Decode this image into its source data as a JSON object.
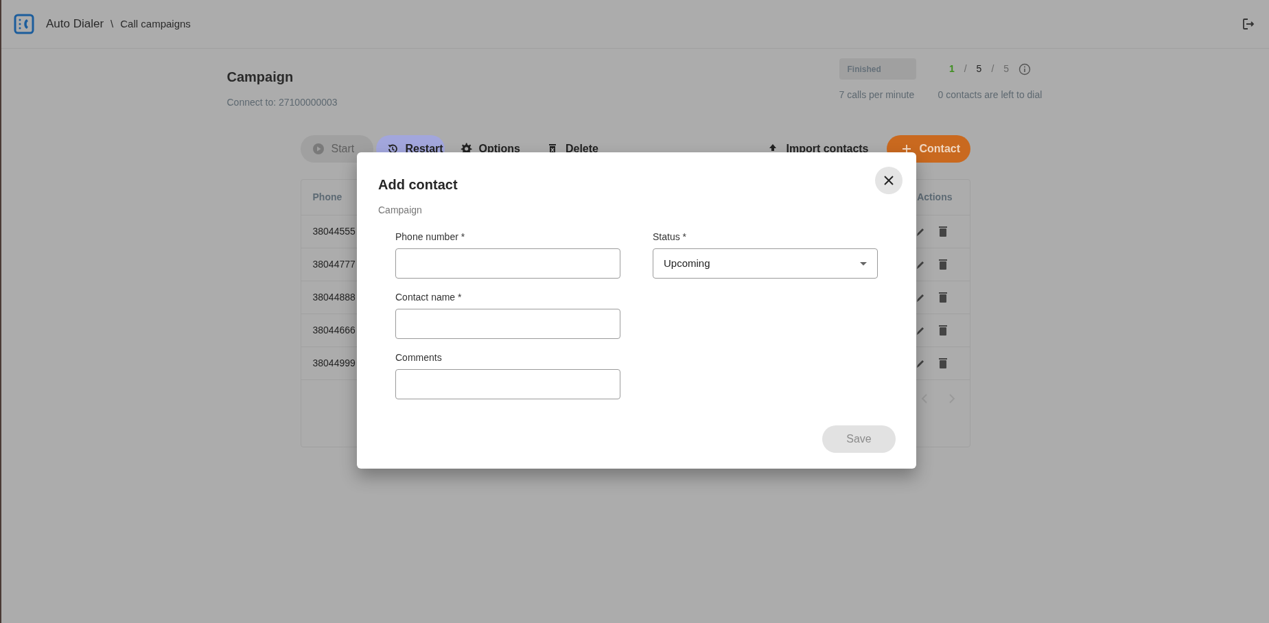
{
  "header": {
    "app_name": "Auto Dialer",
    "separator": "\\",
    "page": "Call campaigns"
  },
  "campaign": {
    "title": "Campaign",
    "connect_to": "Connect to: 27100000003",
    "status_badge": "Finished",
    "rate": "7 calls per minute",
    "counts": [
      {
        "text": "1",
        "kind": "success"
      },
      {
        "text": "/",
        "kind": "separator"
      },
      {
        "text": "5",
        "kind": "total"
      },
      {
        "text": "/",
        "kind": "separator"
      },
      {
        "text": "5",
        "kind": "muted"
      }
    ],
    "left_to_dial": "0 contacts are left to dial"
  },
  "toolbar": [
    {
      "label": "Start",
      "kind": "start",
      "disabled": true
    },
    {
      "label": "Restart",
      "kind": "restart",
      "disabled": false
    },
    {
      "label": "Options",
      "kind": "options",
      "disabled": false
    },
    {
      "label": "Delete",
      "kind": "delete",
      "disabled": false
    },
    {
      "label": "Import contacts",
      "kind": "import",
      "disabled": false
    },
    {
      "label": "Contact",
      "kind": "add",
      "disabled": false
    }
  ],
  "table": {
    "columns": [
      "Phone",
      "Actions"
    ],
    "rows": [
      {
        "phone": "38044555"
      },
      {
        "phone": "38044777"
      },
      {
        "phone": "38044888"
      },
      {
        "phone": "38044666"
      },
      {
        "phone": "38044999"
      }
    ]
  },
  "modal": {
    "title": "Add contact",
    "subtitle": "Campaign",
    "fields": [
      {
        "label": "Phone number *",
        "kind": "text"
      },
      {
        "label": "Status *",
        "kind": "select",
        "value": "Upcoming"
      },
      {
        "label": "Contact name *",
        "kind": "text"
      },
      {
        "label": "Comments",
        "kind": "text"
      }
    ],
    "save": {
      "label": "Save",
      "disabled": true
    }
  }
}
